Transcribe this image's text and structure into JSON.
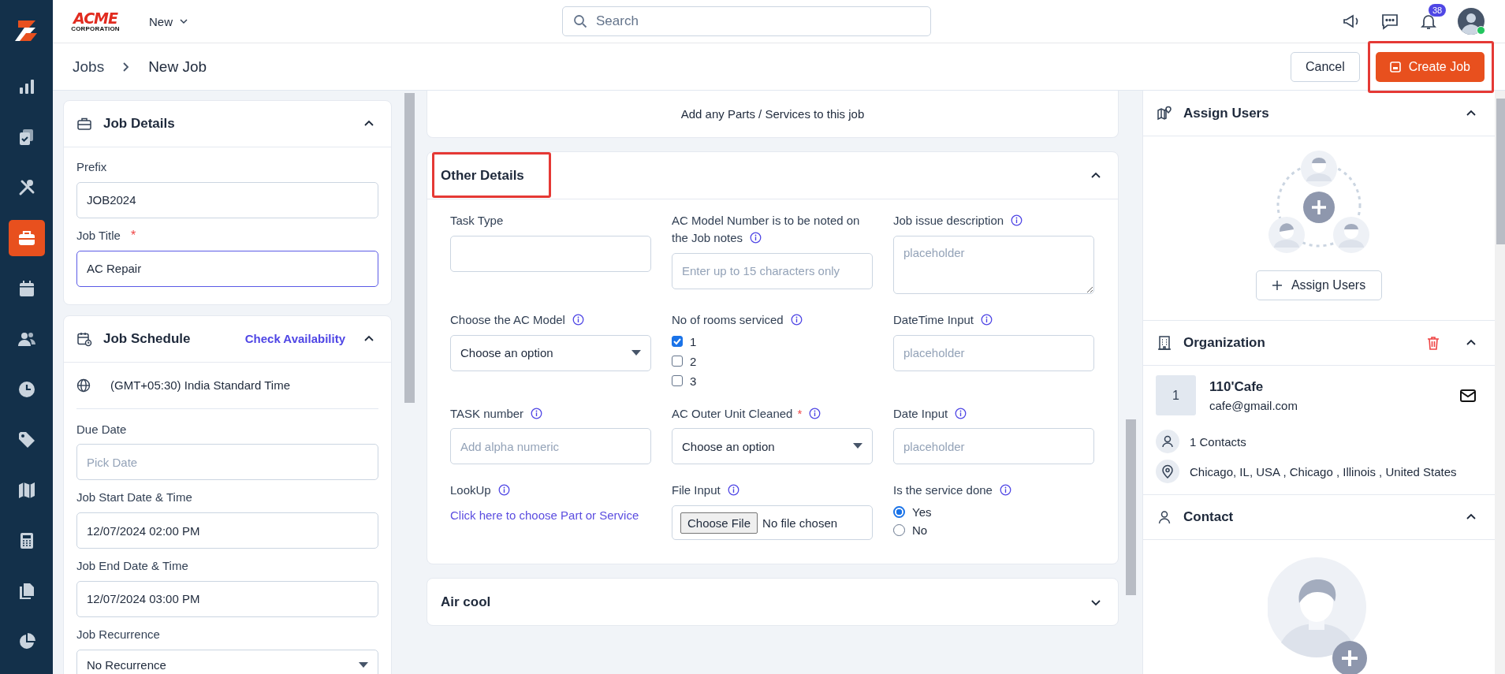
{
  "nav": {
    "items": [
      {
        "selected": false
      },
      {
        "selected": false
      },
      {
        "selected": false
      },
      {
        "selected": true
      },
      {
        "selected": false
      },
      {
        "selected": false
      },
      {
        "selected": false
      },
      {
        "selected": false
      },
      {
        "selected": false
      },
      {
        "selected": false
      },
      {
        "selected": false
      },
      {
        "selected": false
      }
    ]
  },
  "topbar": {
    "logo": {
      "word": "ACME",
      "sub": "CORPORATION"
    },
    "menu": "New",
    "search": {
      "placeholder": "Search"
    },
    "notification_count": "38"
  },
  "breadcrumb": [
    "Jobs",
    "New Job"
  ],
  "actions": {
    "cancel": "Cancel",
    "create": {
      "label": "Create Job",
      "highlighted": true
    }
  },
  "job_details": {
    "title": "Job Details",
    "expanded": true,
    "fields": [
      {
        "kind": "text",
        "label": "Prefix",
        "value": "JOB2024",
        "focused": false
      },
      {
        "kind": "text",
        "label": "Job Title",
        "required_mark": "*",
        "value": "AC Repair",
        "focused": true
      }
    ]
  },
  "job_schedule": {
    "title": "Job Schedule",
    "action": "Check Availability",
    "expanded": true,
    "timezone": "(GMT+05:30) India Standard Time",
    "fields": [
      {
        "kind": "text",
        "label": "Due Date",
        "placeholder": "Pick Date",
        "focused": false
      },
      {
        "kind": "text",
        "label": "Job Start Date & Time",
        "value": "12/07/2024 02:00 PM",
        "focused": false
      },
      {
        "kind": "text",
        "label": "Job End Date & Time",
        "value": "12/07/2024 03:00 PM",
        "focused": false
      },
      {
        "kind": "select",
        "label": "Job Recurrence",
        "value": "No Recurrence"
      }
    ]
  },
  "parts": {
    "text": "Add any Parts / Services to this job"
  },
  "other_details": {
    "title": "Other Details",
    "highlighted": true,
    "expanded": true,
    "fields": [
      {
        "kind": "text",
        "label": "Task Type",
        "info": false
      },
      {
        "kind": "text",
        "label": "AC Model Number is to be noted on the Job notes",
        "info": true,
        "placeholder": "Enter up to 15 characters only"
      },
      {
        "kind": "textarea",
        "label": "Job issue description",
        "info": true,
        "placeholder": "placeholder"
      },
      {
        "kind": "select",
        "label": "Choose the AC Model",
        "info": true,
        "value": "Choose an option"
      },
      {
        "kind": "checkboxes",
        "label": "No of rooms serviced",
        "info": true,
        "options": [
          {
            "label": "1",
            "checked": true
          },
          {
            "label": "2",
            "checked": false
          },
          {
            "label": "3",
            "checked": false
          }
        ]
      },
      {
        "kind": "text",
        "label": "DateTime Input",
        "info": true,
        "placeholder": "placeholder"
      },
      {
        "kind": "text",
        "label": "TASK number",
        "info": true,
        "placeholder": "Add alpha numeric"
      },
      {
        "kind": "select",
        "label": "AC Outer Unit Cleaned",
        "required_mark": "*",
        "info": true,
        "value": "Choose an option"
      },
      {
        "kind": "text",
        "label": "Date Input",
        "info": true,
        "placeholder": "placeholder"
      },
      {
        "kind": "link",
        "label": "LookUp",
        "info": true,
        "link": "Click here to choose Part or Service"
      },
      {
        "kind": "file",
        "label": "File Input",
        "info": true,
        "button": "Choose File",
        "status": "No file chosen"
      },
      {
        "kind": "radios",
        "label": "Is the service done",
        "info": true,
        "options": [
          {
            "label": "Yes",
            "selected": true
          },
          {
            "label": "No",
            "selected": false
          }
        ]
      }
    ]
  },
  "air_cool": {
    "title": "Air cool",
    "expanded": false
  },
  "assign_users": {
    "title": "Assign Users",
    "expanded": true,
    "button": "Assign Users"
  },
  "organization": {
    "title": "Organization",
    "expanded": true,
    "avatar": "1",
    "name": "110'Cafe",
    "email": "cafe@gmail.com",
    "contacts": "1 Contacts",
    "address": "Chicago, IL, USA , Chicago , Illinois , United States"
  },
  "contact": {
    "title": "Contact",
    "expanded": true
  }
}
